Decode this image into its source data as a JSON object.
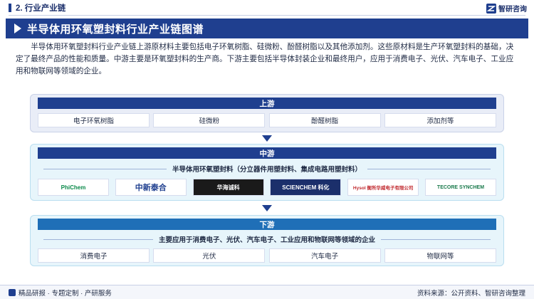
{
  "section": {
    "title": "2. 行业产业链"
  },
  "brand": {
    "name": "智研咨询",
    "logo_icon": "zhiyan-logo-icon"
  },
  "banner": {
    "title": "半导体用环氧塑封料行业产业链图谱"
  },
  "intro": "半导体用环氧塑封料行业产业链上游原材料主要包括电子环氧树脂、硅微粉、酚醛树脂以及其他添加剂。这些原材料是生产环氧塑封料的基础，决定了最终产品的性能和质量。中游主要是环氧塑封料的生产商。下游主要包括半导体封装企业和最终用户，应用于消费电子、光伏、汽车电子、工业应用和物联网等领域的企业。",
  "upstream": {
    "title": "上游",
    "items": [
      "电子环氧树脂",
      "硅微粉",
      "酚醛树脂",
      "添加剂等"
    ]
  },
  "midstream": {
    "title": "中游",
    "subtitle": "半导体用环氧塑封料（分立器件用塑封料、集成电路用塑封料）",
    "logos": [
      {
        "text": "PhiChem",
        "color": "#0b8a4a"
      },
      {
        "text": "中新泰合",
        "color": "#1f3f8f"
      },
      {
        "text": "华海诚科",
        "color": "#ffffff",
        "bg": "#1a1a1a"
      },
      {
        "text": "SCIENCHEM 科化",
        "color": "#ffffff",
        "bg": "#1b2f6b"
      },
      {
        "text": "Hysol 衡所华威电子有限公司",
        "color": "#c0282d"
      },
      {
        "text": "TECORE SYNCHEM",
        "color": "#1a7a4c"
      }
    ]
  },
  "downstream": {
    "title": "下游",
    "subtitle": "主要应用于消费电子、光伏、汽车电子、工业应用和物联网等领域的企业",
    "items": [
      "消费电子",
      "光伏",
      "汽车电子",
      "物联网等"
    ]
  },
  "footer": {
    "left": "精品研报 · 专题定制 · 产研服务",
    "right": "资料来源：公开资料、智研咨询整理"
  },
  "colors": {
    "primary": "#1f3f8f",
    "accent": "#1f6fb7"
  }
}
